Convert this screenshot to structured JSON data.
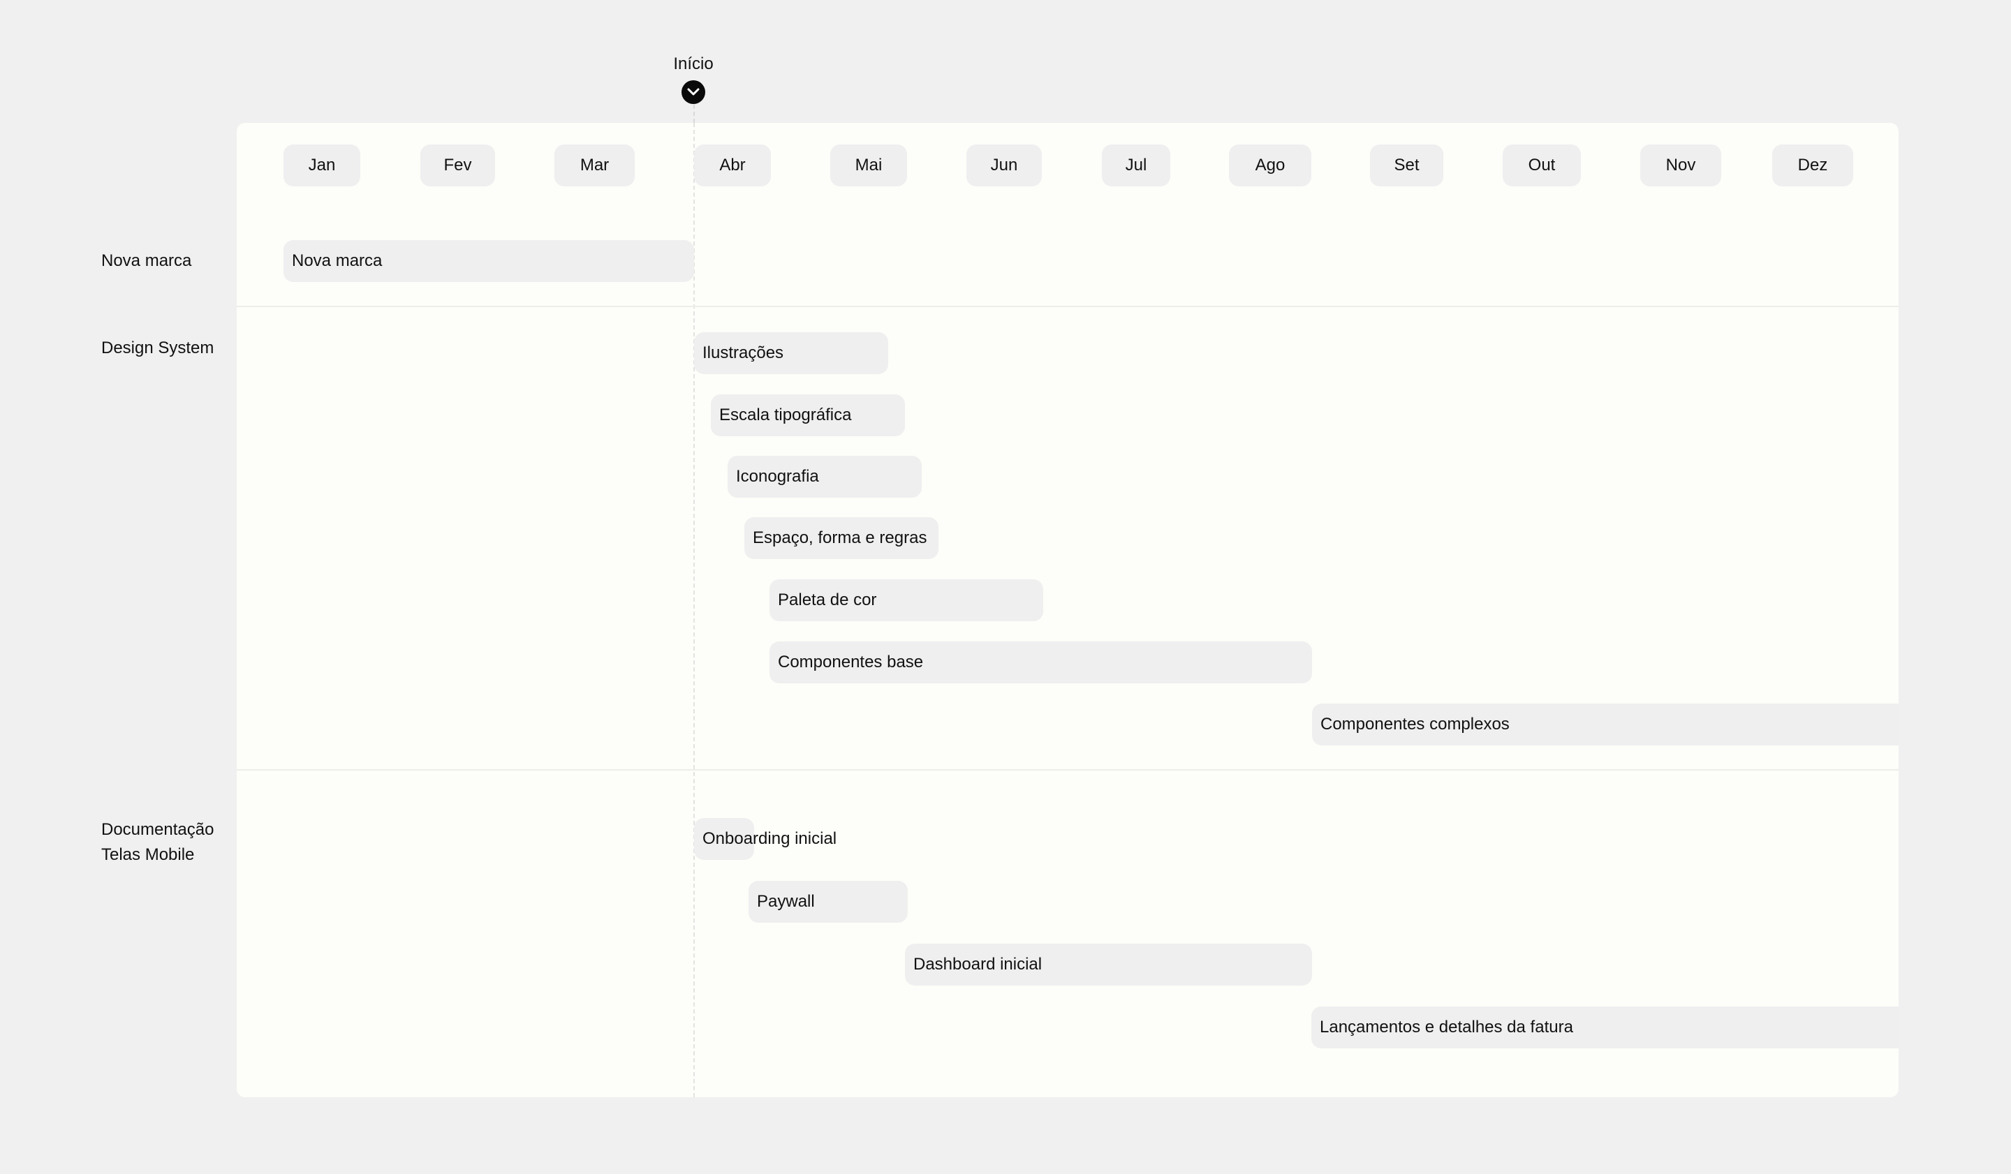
{
  "marker": {
    "label": "Início",
    "icon": "chevron-down-icon"
  },
  "months": [
    "Jan",
    "Fev",
    "Mar",
    "Abr",
    "Mai",
    "Jun",
    "Jul",
    "Ago",
    "Set",
    "Out",
    "Nov",
    "Dez"
  ],
  "rows": {
    "nova_marca": {
      "label": "Nova marca"
    },
    "design_system": {
      "label": "Design System"
    },
    "documentacao": {
      "label_line1": "Documentação",
      "label_line2": "Telas Mobile"
    }
  },
  "tasks": {
    "nova_marca": [
      "Nova marca"
    ],
    "design_system": [
      "Ilustrações",
      "Escala tipográfica",
      "Iconografia",
      "Espaço, forma e regras",
      "Paleta de cor",
      "Componentes base",
      "Componentes complexos"
    ],
    "documentacao": [
      "Onboarding inicial",
      "Paywall",
      "Dashboard inicial",
      "Lançamentos e detalhes da fatura"
    ]
  },
  "colors": {
    "background": "#f0f0f1",
    "board": "#fdfdf9",
    "pill": "#efeff0",
    "marker": "#0a0a0a"
  }
}
